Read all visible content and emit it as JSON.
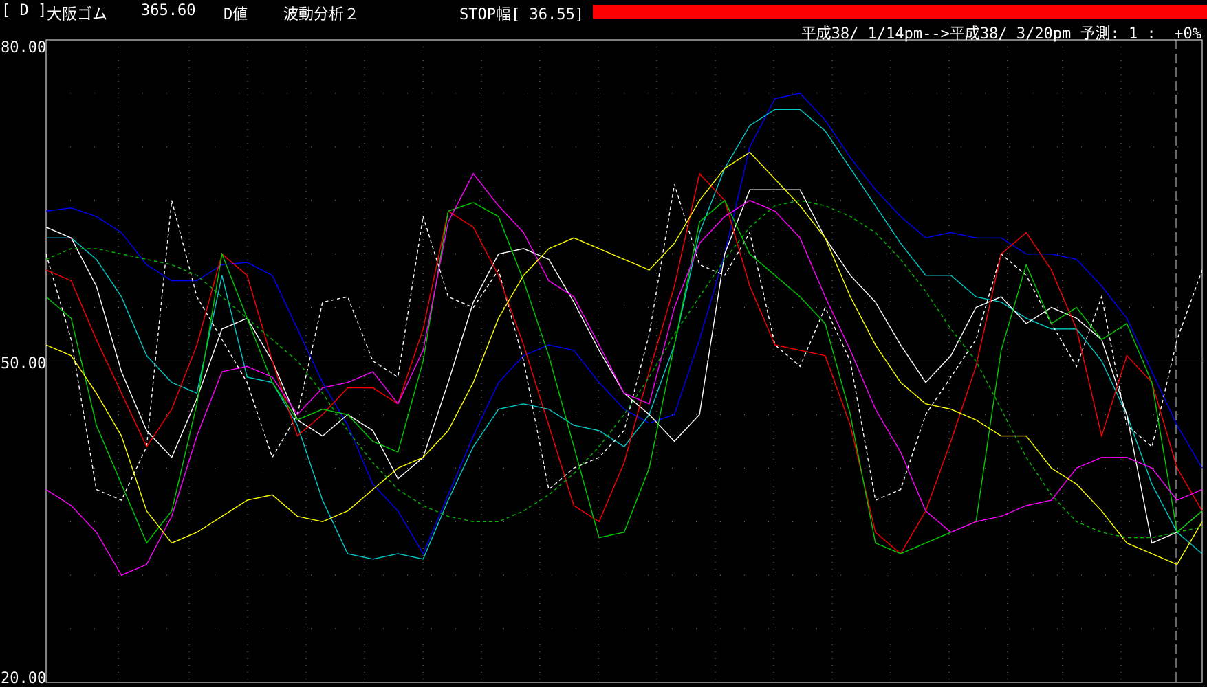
{
  "header": {
    "symbol_tag": "[ D ]",
    "name": "大阪ゴム",
    "price": "365.60",
    "mode": "D値",
    "analysis": "波動分析２",
    "stop_label": "STOP幅[ 36.55]",
    "stop_bar_color": "#ff0000",
    "period": "平成38/ 1/14pm-->平成38/ 3/20pm 予測: 1 :  +0%"
  },
  "chart_data": {
    "type": "line",
    "title": "",
    "xlabel": "",
    "ylabel": "",
    "ylim": [
      20,
      80
    ],
    "yticks": [
      "80.00",
      "50.00",
      "20.00"
    ],
    "midline": 50,
    "grid": "dotted",
    "series": [
      {
        "color": "#0000ff",
        "style": "solid",
        "values": [
          64,
          64.3,
          63.5,
          62,
          59,
          57.5,
          57.5,
          59,
          59.2,
          58,
          53,
          48,
          44,
          38.5,
          36,
          32,
          37.5,
          43,
          48,
          50.5,
          51.5,
          51,
          48,
          45.5,
          44.2,
          45,
          52,
          60,
          70,
          74.5,
          75,
          72.5,
          69,
          66,
          63.5,
          61.5,
          62,
          61.5,
          61.5,
          60,
          60,
          59.5,
          57,
          54,
          49,
          44,
          40
        ]
      },
      {
        "color": "#00cccc",
        "style": "solid",
        "values": [
          61.5,
          61.5,
          59.5,
          56,
          50.5,
          48,
          47,
          58,
          48.5,
          48,
          44,
          37,
          32,
          31.5,
          32,
          31.5,
          37,
          42,
          45.5,
          46,
          45.5,
          44,
          43.5,
          42,
          45,
          51.5,
          62,
          68,
          72,
          73.5,
          73.5,
          71.5,
          68,
          64.5,
          61,
          58,
          58,
          56,
          55.5,
          54,
          53,
          53,
          50,
          45,
          38.5,
          34,
          32
        ]
      },
      {
        "color": "#ffffff",
        "style": "solid",
        "values": [
          62.5,
          61.5,
          57,
          49,
          43.5,
          41,
          46.5,
          53,
          54,
          50,
          44.5,
          43,
          45,
          43.5,
          39,
          41,
          48,
          55.5,
          60,
          60.5,
          59.5,
          55.5,
          51,
          47,
          45,
          42.5,
          45,
          60,
          66,
          66,
          66,
          61.5,
          58,
          55.5,
          51.5,
          48,
          50.5,
          55,
          56,
          53.5,
          55,
          54,
          52,
          45,
          33,
          34,
          36
        ]
      },
      {
        "color": "#ffffff",
        "style": "dashed",
        "values": [
          60,
          52,
          38,
          37,
          42,
          65,
          56,
          52,
          48,
          41,
          45,
          55.5,
          56,
          50,
          48.5,
          63.5,
          56,
          55,
          58.5,
          50,
          38,
          40,
          41,
          43.5,
          52.5,
          66.5,
          59,
          58,
          62,
          51.5,
          49.5,
          55,
          50,
          37,
          38,
          45,
          48.5,
          52,
          60,
          58,
          53.5,
          49.5,
          56,
          44,
          42,
          52,
          58.5
        ]
      },
      {
        "color": "#ff0000",
        "style": "solid",
        "values": [
          58.5,
          57.5,
          52,
          47,
          42,
          45.5,
          51.5,
          60,
          58,
          50,
          43,
          45,
          47.5,
          47.5,
          46,
          53,
          64,
          62.5,
          58,
          51.5,
          44,
          36.5,
          35,
          40.5,
          49,
          57,
          67.5,
          65,
          57,
          51.5,
          51,
          50.5,
          44,
          34,
          32,
          36,
          42.5,
          49.5,
          60,
          62,
          58.5,
          53,
          43,
          50.5,
          48,
          40,
          36
        ]
      },
      {
        "color": "#00cc00",
        "style": "solid",
        "values": [
          56,
          54,
          44,
          38.5,
          33,
          36,
          46,
          60,
          54,
          48,
          44.5,
          45.5,
          45,
          42.5,
          41.5,
          50,
          64,
          64.8,
          63.5,
          57.5,
          50.5,
          42,
          33.5,
          34,
          40,
          51.5,
          63,
          65,
          60,
          58,
          56,
          53.5,
          45,
          33,
          32,
          33,
          34,
          35,
          51,
          59,
          53.5,
          55,
          52,
          53.5,
          48,
          34,
          36
        ]
      },
      {
        "color": "#ff00ff",
        "style": "solid",
        "values": [
          38,
          36.5,
          34,
          30,
          31,
          35.5,
          43,
          49,
          49.5,
          48.5,
          45,
          47.5,
          48,
          49,
          46,
          51,
          63,
          67.5,
          64.5,
          62,
          57.5,
          56,
          51.5,
          47,
          46,
          55,
          61,
          63.5,
          65,
          64,
          61.5,
          56,
          51,
          45.5,
          41.5,
          36,
          34,
          35,
          35.5,
          36.5,
          37,
          40,
          41,
          41,
          40,
          37,
          38
        ]
      },
      {
        "color": "#ffff00",
        "style": "solid",
        "values": [
          51.5,
          50.5,
          47,
          43,
          36,
          33,
          34,
          35.5,
          37,
          37.5,
          35.5,
          35,
          36,
          38,
          40,
          41,
          43.5,
          48,
          54,
          58,
          60.5,
          61.5,
          60.5,
          59.5,
          58.5,
          61,
          65,
          68,
          69.5,
          67,
          64.5,
          61.5,
          56,
          51.5,
          48,
          46,
          45.5,
          44.5,
          43,
          43,
          40,
          38.5,
          36,
          33,
          32,
          31,
          35
        ]
      },
      {
        "color": "#00bb00",
        "style": "dashed",
        "values": [
          59.5,
          60.5,
          60.5,
          60,
          59.5,
          59,
          58,
          56,
          54,
          52,
          50,
          47,
          43.5,
          40.5,
          38,
          36.5,
          35.5,
          35,
          35,
          36,
          37.5,
          39.5,
          42,
          45,
          48.5,
          52.5,
          56,
          59.5,
          62.5,
          64.5,
          65,
          64.5,
          63.5,
          62,
          59.5,
          56.5,
          53,
          50,
          45.5,
          41,
          37.5,
          35,
          34,
          33.5,
          33.5,
          34,
          34.5
        ]
      }
    ]
  }
}
